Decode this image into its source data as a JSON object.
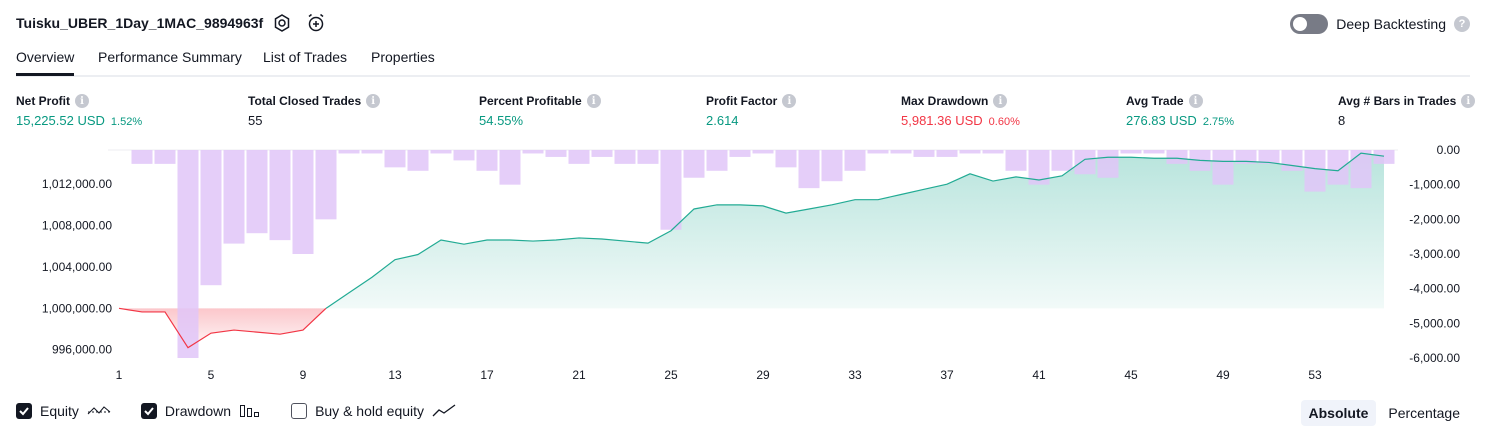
{
  "header": {
    "title": "Tuisku_UBER_1Day_1MAC_9894963f",
    "settings_icon": "gear-icon",
    "alert_icon": "alarm-add-icon",
    "deep_backtesting_label": "Deep Backtesting",
    "deep_backtesting_enabled": false,
    "help_icon": "?"
  },
  "tabs": [
    {
      "label": "Overview",
      "active": true
    },
    {
      "label": "Performance Summary",
      "active": false
    },
    {
      "label": "List of Trades",
      "active": false
    },
    {
      "label": "Properties",
      "active": false
    }
  ],
  "metrics": [
    {
      "label": "Net Profit",
      "value": "15,225.52 USD",
      "sub": "1.52%",
      "color": "green"
    },
    {
      "label": "Total Closed Trades",
      "value": "55",
      "sub": "",
      "color": "default"
    },
    {
      "label": "Percent Profitable",
      "value": "54.55%",
      "sub": "",
      "color": "green"
    },
    {
      "label": "Profit Factor",
      "value": "2.614",
      "sub": "",
      "color": "green"
    },
    {
      "label": "Max Drawdown",
      "value": "5,981.36 USD",
      "sub": "0.60%",
      "color": "red"
    },
    {
      "label": "Avg Trade",
      "value": "276.83 USD",
      "sub": "2.75%",
      "color": "green"
    },
    {
      "label": "Avg # Bars in Trades",
      "value": "8",
      "sub": "",
      "color": "default"
    }
  ],
  "info_icon": "i",
  "chart_data": {
    "type": "line",
    "x": [
      1,
      2,
      3,
      4,
      5,
      6,
      7,
      8,
      9,
      10,
      11,
      12,
      13,
      14,
      15,
      16,
      17,
      18,
      19,
      20,
      21,
      22,
      23,
      24,
      25,
      26,
      27,
      28,
      29,
      30,
      31,
      32,
      33,
      34,
      35,
      36,
      37,
      38,
      39,
      40,
      41,
      42,
      43,
      44,
      45,
      46,
      47,
      48,
      49,
      50,
      51,
      52,
      53,
      54,
      55,
      56
    ],
    "xticks": [
      "1",
      "5",
      "9",
      "13",
      "17",
      "21",
      "25",
      "29",
      "33",
      "37",
      "41",
      "45",
      "49",
      "53"
    ],
    "equity": [
      1000000,
      999650,
      999650,
      996200,
      997600,
      997900,
      997700,
      997500,
      997900,
      1000000,
      1001500,
      1003000,
      1004700,
      1005200,
      1006600,
      1006200,
      1006600,
      1006600,
      1006500,
      1006600,
      1006800,
      1006700,
      1006500,
      1006300,
      1007500,
      1009600,
      1010000,
      1010000,
      1009900,
      1009200,
      1009600,
      1010000,
      1010500,
      1010500,
      1011000,
      1011500,
      1012000,
      1013000,
      1012300,
      1012700,
      1012400,
      1012800,
      1014400,
      1014600,
      1014600,
      1014500,
      1014500,
      1014300,
      1014200,
      1014200,
      1014100,
      1013800,
      1013500,
      1013300,
      1015000,
      1014700
    ],
    "drawdown": [
      0,
      -400,
      -400,
      -6000,
      -3900,
      -2700,
      -2400,
      -2600,
      -3000,
      -2000,
      -100,
      -100,
      -500,
      -600,
      -100,
      -300,
      -600,
      -1000,
      -100,
      -200,
      -400,
      -200,
      -400,
      -400,
      -2300,
      -800,
      -600,
      -200,
      -100,
      -500,
      -1100,
      -900,
      -600,
      -100,
      -100,
      -200,
      -200,
      -100,
      -100,
      -600,
      -1000,
      -600,
      -700,
      -800,
      -100,
      -100,
      -400,
      -600,
      -1000,
      -400,
      -400,
      -600,
      -1200,
      -1000,
      -1100,
      -400
    ],
    "y_left_ticks": [
      "996,000.00",
      "1,000,000.00",
      "1,004,000.00",
      "1,008,000.00",
      "1,012,000.00"
    ],
    "y_right_ticks": [
      "0.00",
      "-1,000.00",
      "-2,000.00",
      "-3,000.00",
      "-4,000.00",
      "-5,000.00",
      "-6,000.00"
    ],
    "y_left_range": [
      995200,
      1015300
    ],
    "y_right_range": [
      -6000,
      0
    ],
    "colors": {
      "equity_positive": "#22ab94",
      "equity_negative": "#f23645",
      "drawdown_bar": "#e1c6f8"
    }
  },
  "legend": {
    "items": [
      {
        "label": "Equity",
        "checked": true,
        "icon": "equity-line-icon"
      },
      {
        "label": "Drawdown",
        "checked": true,
        "icon": "drawdown-bars-icon"
      },
      {
        "label": "Buy & hold equity",
        "checked": false,
        "icon": "buy-hold-line-icon"
      }
    ]
  },
  "mode_buttons": [
    {
      "label": "Absolute",
      "active": true
    },
    {
      "label": "Percentage",
      "active": false
    }
  ]
}
